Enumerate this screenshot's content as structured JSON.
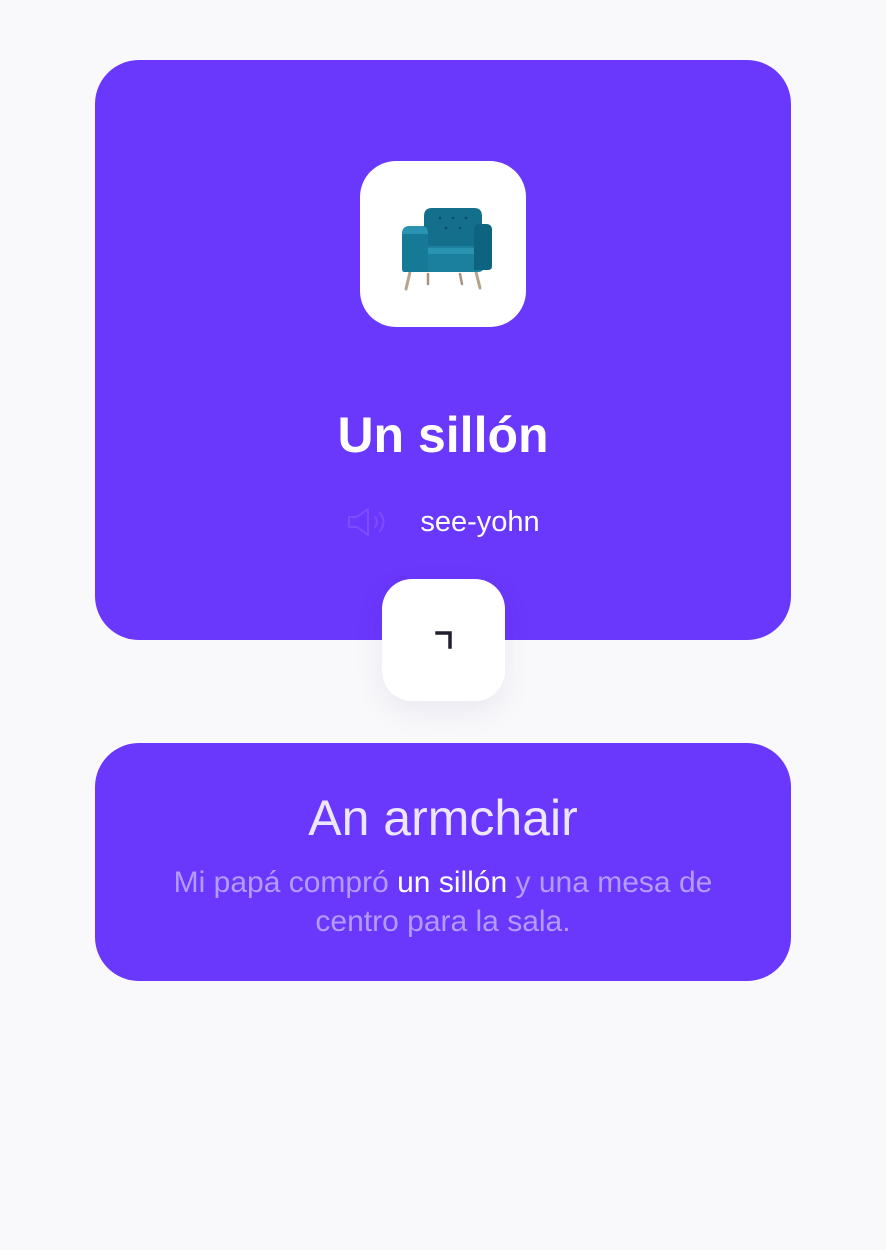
{
  "card": {
    "word": "Un sillón",
    "pronunciation": "see-yohn",
    "image_label": "armchair"
  },
  "translation_card": {
    "translation": "An armchair",
    "example_before": "Mi papá compró ",
    "example_highlight": "un sillón",
    "example_after": " y una mesa de centro para la sala."
  },
  "colors": {
    "card_bg": "#6a37fc",
    "page_bg": "#f9f9fb",
    "example_text": "#b49bff",
    "highlight_text": "#ffffff",
    "armchair": "#12708c"
  },
  "icons": {
    "speaker": "speaker-icon",
    "flip": "flip-icon",
    "image": "armchair-image"
  }
}
